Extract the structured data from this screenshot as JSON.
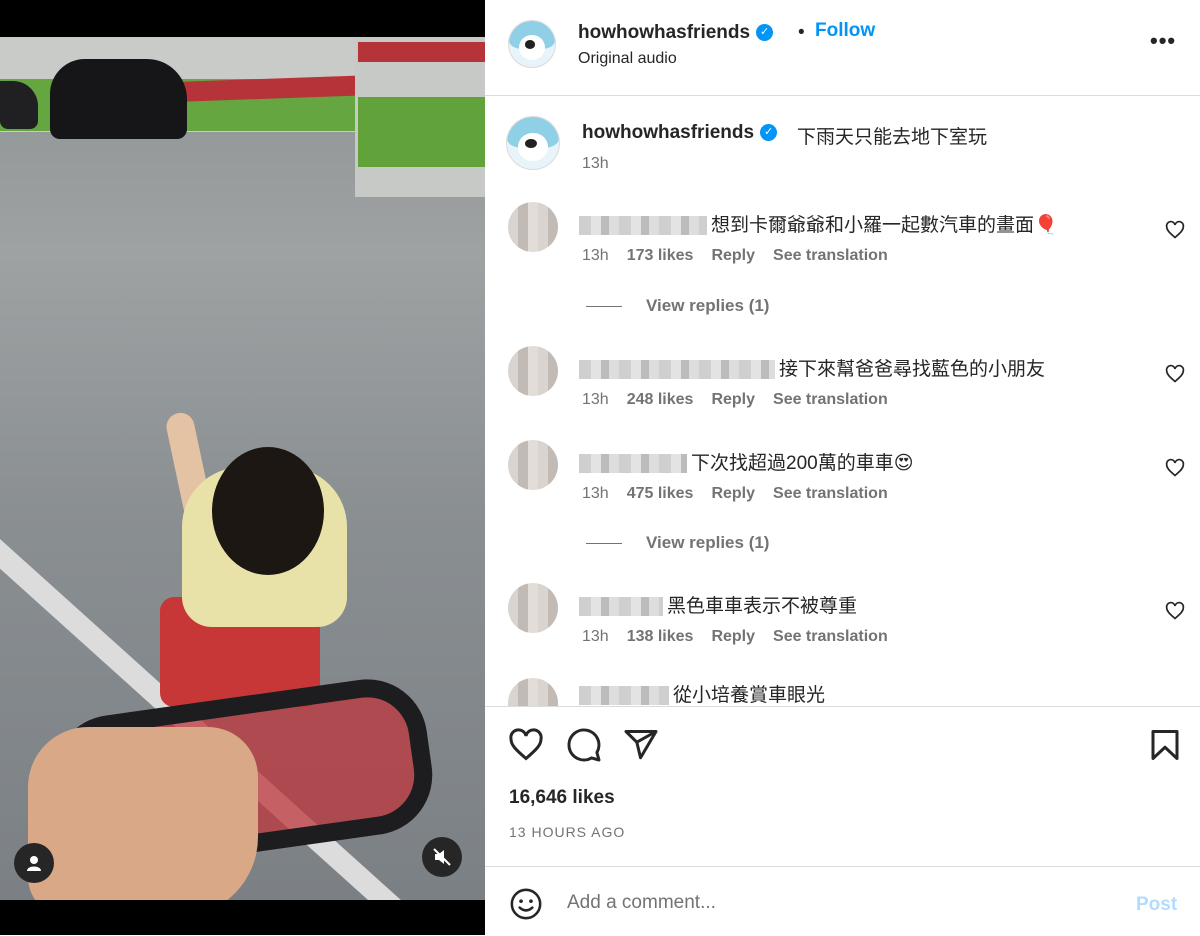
{
  "header": {
    "username": "howhowhasfriends",
    "verified_icon": "verified-check-icon",
    "separator": "•",
    "follow_label": "Follow",
    "audio_label": "Original audio",
    "more_label": "•••"
  },
  "caption": {
    "username": "howhowhasfriends",
    "text": "下雨天只能去地下室玩",
    "time": "13h"
  },
  "comments": [
    {
      "text": "想到卡爾爺爺和小羅一起數汽車的畫面🎈",
      "time": "13h",
      "likes": "173 likes",
      "reply": "Reply",
      "translate": "See translation",
      "replies": "View replies (1)"
    },
    {
      "text": "接下來幫爸爸尋找藍色的小朋友",
      "time": "13h",
      "likes": "248 likes",
      "reply": "Reply",
      "translate": "See translation"
    },
    {
      "text": "下次找超過200萬的車車😍",
      "time": "13h",
      "likes": "475 likes",
      "reply": "Reply",
      "translate": "See translation",
      "replies": "View replies (1)"
    },
    {
      "text": "黑色車車表示不被尊重",
      "time": "13h",
      "likes": "138 likes",
      "reply": "Reply",
      "translate": "See translation"
    },
    {
      "text": "從小培養賞車眼光"
    }
  ],
  "actions": {
    "likes": "16,646 likes",
    "time_ago": "13 HOURS AGO"
  },
  "composer": {
    "placeholder": "Add a comment...",
    "post_label": "Post"
  },
  "colors": {
    "accent": "#0095f6",
    "post_disabled": "#b3dbff",
    "muted_text": "#737373"
  }
}
